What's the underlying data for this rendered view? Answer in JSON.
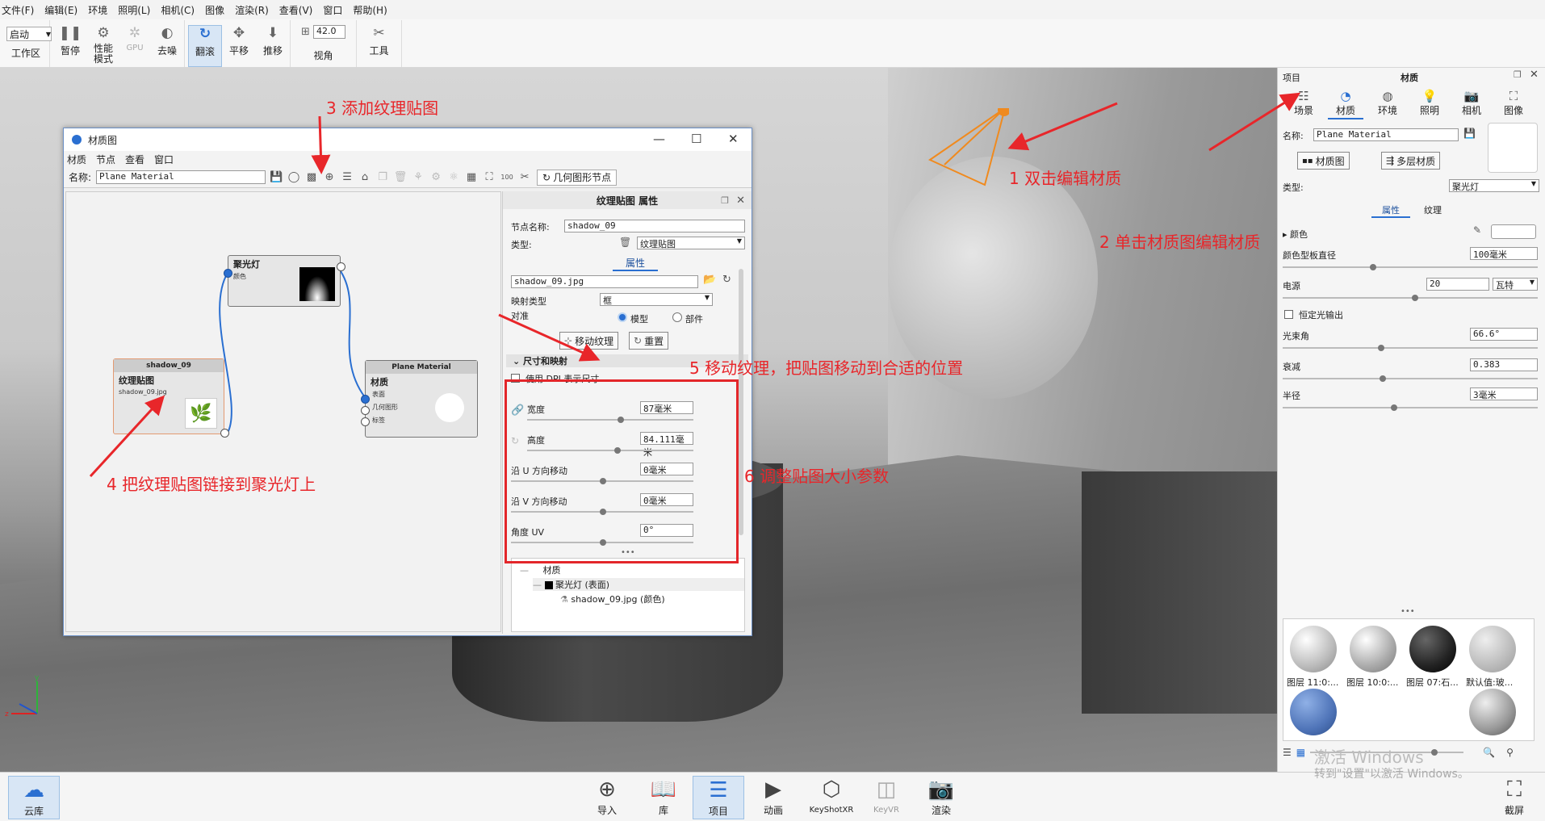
{
  "menubar": [
    "文件(F)",
    "编辑(E)",
    "环境",
    "照明(L)",
    "相机(C)",
    "图像",
    "渲染(R)",
    "查看(V)",
    "窗口",
    "帮助(H)"
  ],
  "toolbar": {
    "start_value": "启动",
    "workspace": "工作区",
    "buttons": [
      {
        "label": "暂停",
        "icon": "pause-icon"
      },
      {
        "label": "性能模式",
        "icon": "performance-icon"
      },
      {
        "label": "GPU",
        "icon": "gpu-icon"
      },
      {
        "label": "去噪",
        "icon": "denoise-icon"
      },
      {
        "label": "翻滚",
        "icon": "tumble-icon"
      },
      {
        "label": "平移",
        "icon": "pan-icon"
      },
      {
        "label": "推移",
        "icon": "dolly-icon"
      }
    ],
    "fov_value": "42.0",
    "fov_label": "视角",
    "tools_label": "工具"
  },
  "material_window": {
    "title": "材质图",
    "menu": [
      "材质",
      "节点",
      "查看",
      "窗口"
    ],
    "name_label": "名称:",
    "name_value": "Plane Material",
    "geo_node_label": "几何图形节点",
    "nodes": {
      "spotlight": {
        "title": "聚光灯",
        "port": "颜色"
      },
      "texture": {
        "header": "shadow_09",
        "title": "纹理贴图",
        "file": "shadow_09.jpg"
      },
      "material": {
        "header": "Plane Material",
        "title": "材质",
        "ports": [
          "表面",
          "几何图形",
          "标签"
        ]
      }
    },
    "props": {
      "title": "纹理贴图  属性",
      "node_name_label": "节点名称:",
      "node_name_value": "shadow_09",
      "type_label": "类型:",
      "type_value": "纹理贴图",
      "tab_label": "属性",
      "file_value": "shadow_09.jpg",
      "mapping_label": "映射类型",
      "mapping_value": "框",
      "align_label": "对准",
      "align_model": "模型",
      "align_part": "部件",
      "move_btn": "移动纹理",
      "reset_btn": "重置",
      "section_label": "尺寸和映射",
      "dpi_label": "使用 DPI 表示尺寸",
      "width_label": "宽度",
      "width_value": "87毫米",
      "height_label": "高度",
      "height_value": "84.111毫米",
      "u_label": "沿 U 方向移动",
      "u_value": "0毫米",
      "v_label": "沿 V 方向移动",
      "v_value": "0毫米",
      "angle_label": "角度 UV",
      "angle_value": "0°",
      "tree": {
        "root": "材质",
        "child": "聚光灯 (表面)",
        "leaf": "shadow_09.jpg (颜色)"
      }
    }
  },
  "right_panel": {
    "project_label": "项目",
    "title": "材质",
    "tabs": [
      "场景",
      "材质",
      "环境",
      "照明",
      "相机",
      "图像"
    ],
    "name_label": "名称:",
    "name_value": "Plane Material",
    "material_graph_btn": "材质图",
    "multilayer_btn": "多层材质",
    "type_label": "类型:",
    "type_value": "聚光灯",
    "subtab_props": "属性",
    "subtab_texture": "纹理",
    "color_label": "颜色",
    "swatch_label": "颜色型板直径",
    "swatch_value": "100毫米",
    "power_label": "电源",
    "power_value": "20",
    "power_unit": "瓦特",
    "constant_label": "恒定光输出",
    "beam_label": "光束角",
    "beam_value": "66.6°",
    "falloff_label": "衰减",
    "falloff_value": "0.383",
    "radius_label": "半径",
    "radius_value": "3毫米",
    "library": [
      "图层 11:0:...",
      "图层 10:0:...",
      "图层 07:石...",
      "默认值:玻..."
    ]
  },
  "bottombar": [
    "云库",
    "导入",
    "库",
    "项目",
    "动画",
    "KeyShotXR",
    "KeyVR",
    "渲染",
    "截屏"
  ],
  "annotations": {
    "a1": "1 双击编辑材质",
    "a2": "2 单击材质图编辑材质",
    "a3": "3 添加纹理贴图",
    "a4": "4 把纹理贴图链接到聚光灯上",
    "a5": "5 移动纹理，把贴图移动到合适的位置",
    "a6": "6 调整贴图大小参数"
  },
  "watermark": {
    "line1": "激活 Windows",
    "line2": "转到\"设置\"以激活 Windows。"
  },
  "colors": {
    "annotation": "#e8262a",
    "accent": "#2a6fd1"
  }
}
